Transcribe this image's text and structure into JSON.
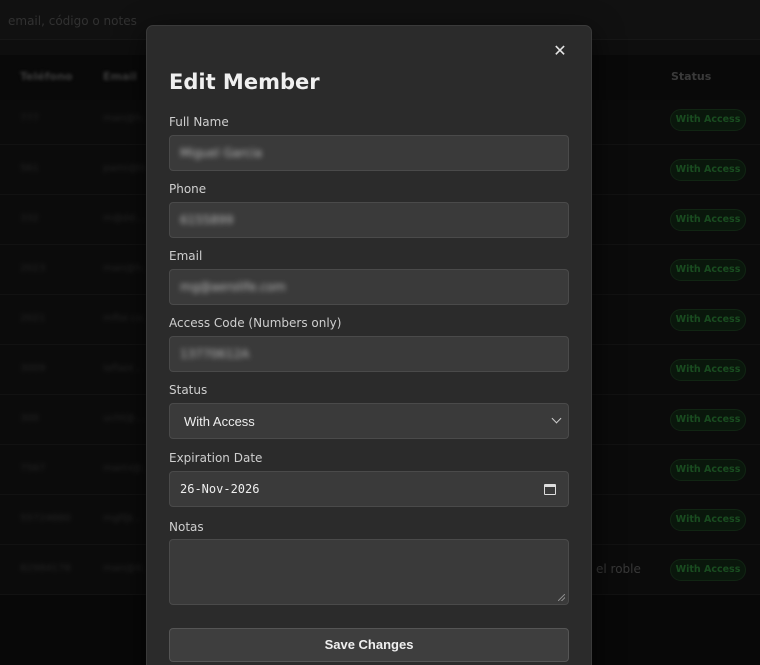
{
  "background": {
    "search_placeholder": "email, código o notes",
    "table_headers": [
      "Teléfono",
      "Email",
      "Status"
    ],
    "rows": [
      {
        "phone": "777",
        "email": "man@h...",
        "status": "With Access"
      },
      {
        "phone": "561",
        "email": "pami@tr...",
        "status": "With Access"
      },
      {
        "phone": "332",
        "email": "m@dd...",
        "status": "With Access"
      },
      {
        "phone": "2023",
        "email": "man@h...",
        "status": "With Access"
      },
      {
        "phone": "2021",
        "email": "mflor.co...",
        "status": "With Access"
      },
      {
        "phone": "3009",
        "email": "laflast...",
        "status": "With Access"
      },
      {
        "phone": "300",
        "email": "ucht@...",
        "status": "With Access"
      },
      {
        "phone": "7567",
        "email": "marni@...",
        "status": "With Access"
      },
      {
        "phone": "55724880",
        "email": "mgf@...",
        "status": "With Access"
      },
      {
        "phone": "82984178",
        "email": "man@4...",
        "status": "With Access"
      }
    ],
    "row_note": "el roble"
  },
  "modal": {
    "title": "Edit Member",
    "close_glyph": "✕",
    "full_name": {
      "label": "Full Name",
      "value": "Miguel Garcia"
    },
    "phone": {
      "label": "Phone",
      "value": "6155899"
    },
    "email": {
      "label": "Email",
      "value": "mg@aerolife.com"
    },
    "access_code": {
      "label": "Access Code (Numbers only)",
      "value": "13770612A"
    },
    "status": {
      "label": "Status",
      "value": "With Access"
    },
    "expiration": {
      "label": "Expiration Date",
      "value": "26-Nov-2026"
    },
    "notes": {
      "label": "Notas",
      "value": ""
    },
    "save_label": "Save Changes"
  },
  "colors": {
    "modal_bg": "#2b2b2b",
    "input_bg": "#3a3a3a",
    "badge_green": "#2f8a3b"
  }
}
